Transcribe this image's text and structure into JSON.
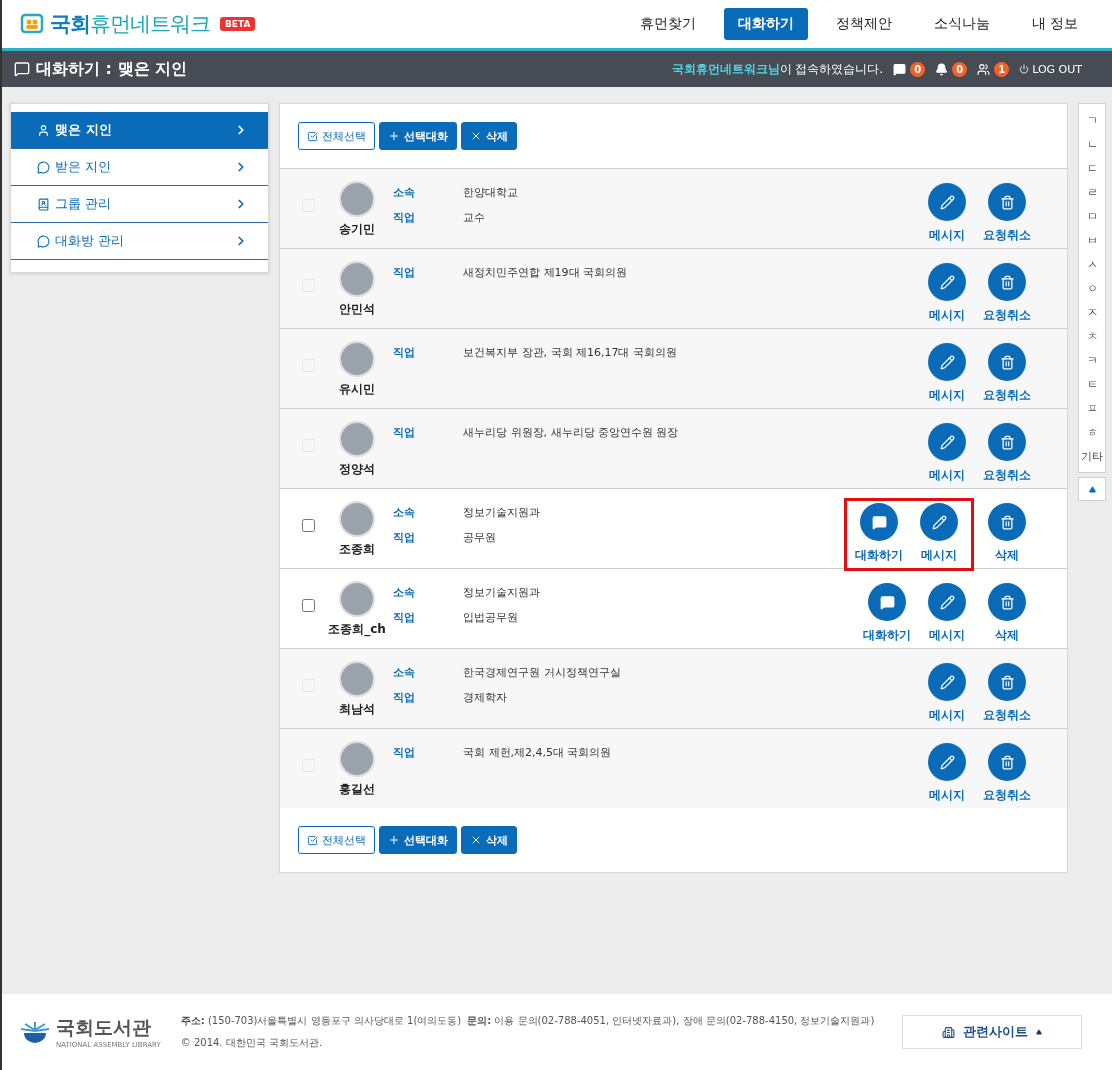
{
  "header": {
    "logo": "**국회**휴먼네트워크",
    "badge": "BETA",
    "nav": [
      {
        "label": "휴먼찾기",
        "selected": false
      },
      {
        "label": "대화하기",
        "selected": true
      },
      {
        "label": "정책제안",
        "selected": false
      },
      {
        "label": "소식나눔",
        "selected": false
      },
      {
        "label": "내 정보",
        "selected": false
      }
    ]
  },
  "subheader": {
    "title": "대화하기 : 맺은 지인",
    "welcome": "**국회휴먼네트워크님**이 접속하였습니다.",
    "counters": [
      {
        "kind": "chat",
        "count": "0"
      },
      {
        "kind": "bell",
        "count": "0"
      },
      {
        "kind": "people",
        "count": "1"
      }
    ],
    "logout": "LOG OUT"
  },
  "sidebar": {
    "items": [
      {
        "label": "맺은 지인",
        "kind": "person",
        "selected": true
      },
      {
        "label": "받은 지인",
        "kind": "chat",
        "selected": false
      },
      {
        "label": "그룹 관리",
        "kind": "book",
        "selected": false
      },
      {
        "label": "대화방 관리",
        "kind": "chat",
        "selected": false
      }
    ]
  },
  "toolbars": [
    {
      "select_all": "전체선택",
      "group_chat": "선택대화",
      "delete": "삭제"
    },
    {
      "select_all": "전체선택",
      "group_chat": "선택대화",
      "delete": "삭제"
    }
  ],
  "rows": [
    {
      "name": "송기민",
      "enabled": false,
      "highlighted": false,
      "fields": [
        {
          "label": "소속",
          "value": "한양대학교"
        },
        {
          "label": "직업",
          "value": "교수"
        }
      ],
      "actions": [
        {
          "kind": "message",
          "label": "메시지"
        },
        {
          "kind": "cancel",
          "label": "요청취소"
        }
      ]
    },
    {
      "name": "안민석",
      "enabled": false,
      "highlighted": false,
      "fields": [
        {
          "label": "직업",
          "value": "새정치민주연합 제19대 국회의원"
        }
      ],
      "actions": [
        {
          "kind": "message",
          "label": "메시지"
        },
        {
          "kind": "cancel",
          "label": "요청취소"
        }
      ]
    },
    {
      "name": "유시민",
      "enabled": false,
      "highlighted": false,
      "fields": [
        {
          "label": "직업",
          "value": "보건복지부 장관, 국회 제16,17대 국회의원"
        }
      ],
      "actions": [
        {
          "kind": "message",
          "label": "메시지"
        },
        {
          "kind": "cancel",
          "label": "요청취소"
        }
      ]
    },
    {
      "name": "정양석",
      "enabled": false,
      "highlighted": false,
      "fields": [
        {
          "label": "직업",
          "value": "새누리당 위원장, 새누리당 중앙연수원 원장"
        }
      ],
      "actions": [
        {
          "kind": "message",
          "label": "메시지"
        },
        {
          "kind": "cancel",
          "label": "요청취소"
        }
      ]
    },
    {
      "name": "조종희",
      "enabled": true,
      "highlighted": true,
      "fields": [
        {
          "label": "소속",
          "value": "정보기술지원과"
        },
        {
          "label": "직업",
          "value": "공무원"
        }
      ],
      "actions": [
        {
          "kind": "chat",
          "label": "대화하기"
        },
        {
          "kind": "message",
          "label": "메시지"
        },
        {
          "kind": "delete",
          "label": "삭제"
        }
      ]
    },
    {
      "name": "조종희_ch",
      "enabled": true,
      "highlighted": false,
      "fields": [
        {
          "label": "소속",
          "value": "정보기술지원과"
        },
        {
          "label": "직업",
          "value": "입법공무원"
        }
      ],
      "actions": [
        {
          "kind": "chat",
          "label": "대화하기"
        },
        {
          "kind": "message",
          "label": "메시지"
        },
        {
          "kind": "delete",
          "label": "삭제"
        }
      ]
    },
    {
      "name": "최남석",
      "enabled": false,
      "highlighted": false,
      "fields": [
        {
          "label": "소속",
          "value": "한국경제연구원 거시정책연구실"
        },
        {
          "label": "직업",
          "value": "경제학자"
        }
      ],
      "actions": [
        {
          "kind": "message",
          "label": "메시지"
        },
        {
          "kind": "cancel",
          "label": "요청취소"
        }
      ]
    },
    {
      "name": "홍길선",
      "enabled": false,
      "highlighted": false,
      "fields": [
        {
          "label": "직업",
          "value": "국회 제헌,제2,4,5대 국회의원"
        }
      ],
      "actions": [
        {
          "kind": "message",
          "label": "메시지"
        },
        {
          "kind": "cancel",
          "label": "요청취소"
        }
      ]
    }
  ],
  "index": [
    "ㄱ",
    "ㄴ",
    "ㄷ",
    "ㄹ",
    "ㅁ",
    "ㅂ",
    "ㅅ",
    "ㅇ",
    "ㅈ",
    "ㅊ",
    "ㅋ",
    "ㅌ",
    "ㅍ",
    "ㅎ",
    "기타"
  ],
  "footer": {
    "logo": "국회도서관",
    "logo_sub": "NATIONAL ASSEMBLY LIBRARY",
    "address": "**주소:** (150-703)서울특별시 영등포구 의사당대로 1(여의도동)",
    "inquiry": "**문의:** 이용 문의(02-788-4051, 인터넷자료과), 장애 문의(02-788-4150, 정보기술지원과)",
    "copyright": "© 2014. 대한민국 국회도서관.",
    "related": "관련사이트"
  }
}
